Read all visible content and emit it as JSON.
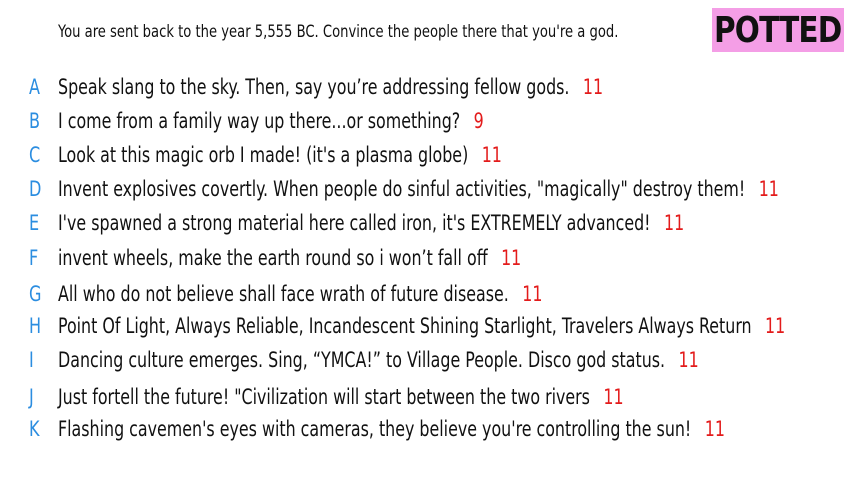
{
  "prompt": "You are sent back to the year 5,555 BC. Convince the people there that you're a god.",
  "badge": "POTTED",
  "colors": {
    "letter": "#2b8de0",
    "score": "#e31b1b",
    "badge_bg": "#f49ee6"
  },
  "answers": [
    {
      "letter": "A",
      "text": "Speak slang to the sky. Then, say you’re addressing fellow gods.",
      "score": "11"
    },
    {
      "letter": "B",
      "text": "I come from a family way up there...or something?",
      "score": "9"
    },
    {
      "letter": "C",
      "text": "Look at this magic orb I made! (it's a plasma globe)",
      "score": "11"
    },
    {
      "letter": "D",
      "text": "Invent explosives covertly. When people do sinful activities, \"magically\" destroy them!",
      "score": "11"
    },
    {
      "letter": "E",
      "text": "I've spawned a strong material here called iron, it's EXTREMELY advanced!",
      "score": "11"
    },
    {
      "letter": "F",
      "text": "invent wheels, make the earth round so i won’t fall off",
      "score": "11"
    },
    {
      "letter": "G",
      "text": "All who do not believe shall face wrath of future disease.",
      "score": "11"
    },
    {
      "letter": "H",
      "text": "Point Of Light, Always Reliable, Incandescent Shining Starlight, Travelers Always Return",
      "score": "11"
    },
    {
      "letter": "I",
      "text": "Dancing culture emerges. Sing, “YMCA!” to Village People. Disco god status.",
      "score": "11"
    },
    {
      "letter": "J",
      "text": "Just fortell the future! \"Civilization will start between the two rivers",
      "score": "11"
    },
    {
      "letter": "K",
      "text": "Flashing cavemen's eyes with cameras, they believe you're controlling the sun!",
      "score": "11"
    }
  ]
}
